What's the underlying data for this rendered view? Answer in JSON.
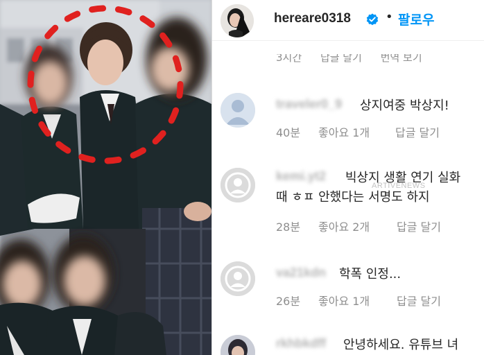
{
  "header": {
    "username": "hereare0318",
    "separator": "•",
    "follow_label": "팔로우"
  },
  "partial_row": {
    "time": "3시간",
    "reply": "답글 달기",
    "translate": "번역 보기"
  },
  "comments": [
    {
      "username": "traveler0_9",
      "text": "상지여중 박상지!",
      "text2": "",
      "time": "40분",
      "likes": "좋아요 1개",
      "reply": "답글 달기"
    },
    {
      "username": "kemi.yt2",
      "text": "빅상지 생활 연기 실화",
      "text2": "때 ㅎㅍ 안했다는 서명도 하지",
      "time": "28분",
      "likes": "좋아요 2개",
      "reply": "답글 달기"
    },
    {
      "username": "va21kdn",
      "text": "학폭 인정...",
      "text2": "",
      "time": "26분",
      "likes": "좋아요 1개",
      "reply": "답글 달기"
    },
    {
      "username": "rkhbkdff",
      "text": "안녕하세요. 유튜브 녀",
      "text2": "",
      "time": "",
      "likes": "",
      "reply": ""
    }
  ],
  "watermark": "ARTIVENEWS",
  "colors": {
    "accent_blue": "#0095f6",
    "meta_gray": "#8e8e8e",
    "text_dark": "#262626",
    "highlight_red": "#e0211f"
  },
  "icons": {
    "verified": "verified-badge-icon",
    "default_avatar": "default-avatar-icon"
  }
}
